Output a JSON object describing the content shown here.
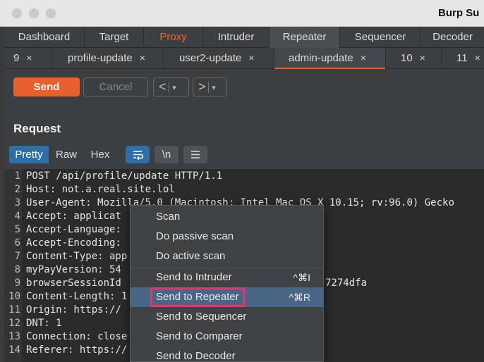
{
  "window": {
    "title": "Burp Su"
  },
  "main_tabs": [
    "Dashboard",
    "Target",
    "Proxy",
    "Intruder",
    "Repeater",
    "Sequencer",
    "Decoder"
  ],
  "repeater_tabs": [
    "9",
    "profile-update",
    "user2-update",
    "admin-update",
    "10",
    "11"
  ],
  "toolbar": {
    "send": "Send",
    "cancel": "Cancel"
  },
  "request": {
    "title": "Request",
    "views": [
      "Pretty",
      "Raw",
      "Hex"
    ],
    "newline_label": "\\n"
  },
  "editor": {
    "lines": [
      "POST /api/profile/update HTTP/1.1",
      "Host: not.a.real.site.lol",
      "User-Agent: Mozilla/5.0 (Macintosh; Intel Mac OS X 10.15; rv:96.0) Gecko",
      "Accept: applicat",
      "Accept-Language:",
      "Accept-Encoding:",
      "Content-Type: app",
      "myPayVersion: 54",
      "browserSessionId",
      "Content-Length: 1",
      "Origin: https://",
      "DNT: 1",
      "Connection: close",
      "Referer: https://"
    ],
    "line_numbers": [
      "1",
      "2",
      "3",
      "4",
      "5",
      "6",
      "7",
      "8",
      "9",
      "10",
      "11",
      "12",
      "13",
      "14"
    ],
    "session_tail": "7274dfa"
  },
  "context_menu": {
    "items": [
      {
        "label": "Scan",
        "shortcut": ""
      },
      {
        "label": "Do passive scan",
        "shortcut": ""
      },
      {
        "label": "Do active scan",
        "shortcut": ""
      },
      {
        "label": "Send to Intruder",
        "shortcut": "^⌘I"
      },
      {
        "label": "Send to Repeater",
        "shortcut": "^⌘R"
      },
      {
        "label": "Send to Sequencer",
        "shortcut": ""
      },
      {
        "label": "Send to Comparer",
        "shortcut": ""
      },
      {
        "label": "Send to Decoder",
        "shortcut": ""
      }
    ]
  }
}
